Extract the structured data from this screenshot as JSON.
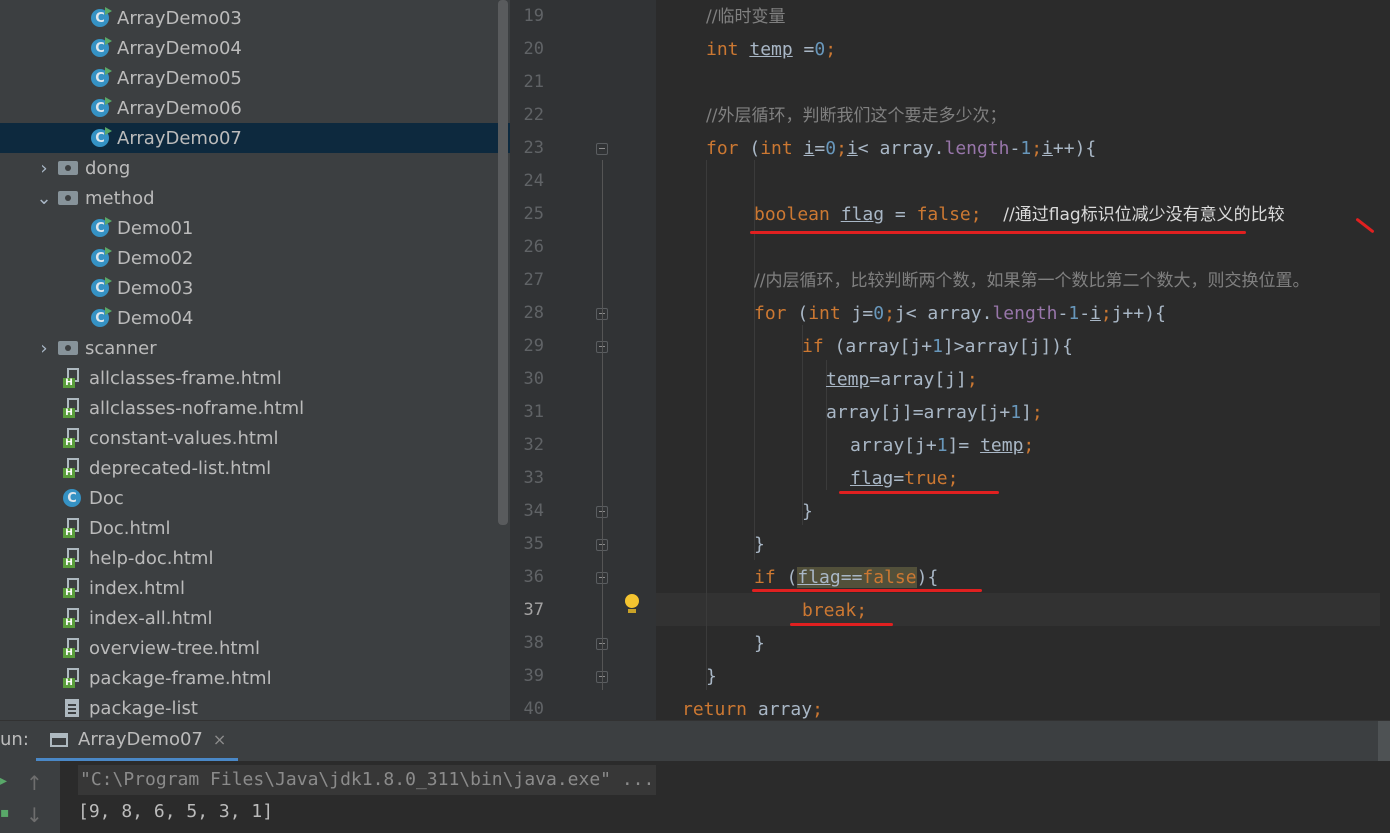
{
  "project_tree": {
    "items": [
      {
        "label": "ArrayDemo03",
        "kind": "class",
        "depth": 2
      },
      {
        "label": "ArrayDemo04",
        "kind": "class",
        "depth": 2
      },
      {
        "label": "ArrayDemo05",
        "kind": "class",
        "depth": 2
      },
      {
        "label": "ArrayDemo06",
        "kind": "class",
        "depth": 2
      },
      {
        "label": "ArrayDemo07",
        "kind": "class",
        "depth": 2,
        "selected": true
      },
      {
        "label": "dong",
        "kind": "folder",
        "depth": 1,
        "expanded": false
      },
      {
        "label": "method",
        "kind": "folder",
        "depth": 1,
        "expanded": true
      },
      {
        "label": "Demo01",
        "kind": "class",
        "depth": 2
      },
      {
        "label": "Demo02",
        "kind": "class",
        "depth": 2
      },
      {
        "label": "Demo03",
        "kind": "class",
        "depth": 2
      },
      {
        "label": "Demo04",
        "kind": "class",
        "depth": 2
      },
      {
        "label": "scanner",
        "kind": "folder",
        "depth": 1,
        "expanded": false
      },
      {
        "label": "allclasses-frame.html",
        "kind": "html",
        "depth": 1
      },
      {
        "label": "allclasses-noframe.html",
        "kind": "html",
        "depth": 1
      },
      {
        "label": "constant-values.html",
        "kind": "html",
        "depth": 1
      },
      {
        "label": "deprecated-list.html",
        "kind": "html",
        "depth": 1
      },
      {
        "label": "Doc",
        "kind": "class-plain",
        "depth": 1
      },
      {
        "label": "Doc.html",
        "kind": "html",
        "depth": 1
      },
      {
        "label": "help-doc.html",
        "kind": "html",
        "depth": 1
      },
      {
        "label": "index.html",
        "kind": "html",
        "depth": 1
      },
      {
        "label": "index-all.html",
        "kind": "html",
        "depth": 1
      },
      {
        "label": "overview-tree.html",
        "kind": "html",
        "depth": 1
      },
      {
        "label": "package-frame.html",
        "kind": "html",
        "depth": 1
      },
      {
        "label": "package-list",
        "kind": "file",
        "depth": 1
      }
    ]
  },
  "editor": {
    "active_line": "37",
    "lines": [
      {
        "num": "19",
        "indent": 0,
        "tokens": [
          {
            "t": "//临时变量",
            "c": "c"
          }
        ]
      },
      {
        "num": "20",
        "indent": 0,
        "tokens": [
          {
            "t": "int",
            "c": "k"
          },
          {
            "t": " "
          },
          {
            "t": "temp",
            "c": "u"
          },
          {
            "t": " ="
          },
          {
            "t": "0",
            "c": "n"
          },
          {
            "t": ";",
            "c": "k"
          }
        ]
      },
      {
        "num": "21",
        "indent": 0,
        "tokens": []
      },
      {
        "num": "22",
        "indent": 0,
        "tokens": [
          {
            "t": "//外层循环，判断我们这个要走多少次；",
            "c": "c"
          }
        ]
      },
      {
        "num": "23",
        "indent": 0,
        "tokens": [
          {
            "t": "for",
            "c": "k"
          },
          {
            "t": " ("
          },
          {
            "t": "int",
            "c": "k"
          },
          {
            "t": " "
          },
          {
            "t": "i",
            "c": "u"
          },
          {
            "t": "="
          },
          {
            "t": "0",
            "c": "n"
          },
          {
            "t": ";",
            "c": "k"
          },
          {
            "t": "i",
            "c": "u"
          },
          {
            "t": "< array."
          },
          {
            "t": "length",
            "c": "m"
          },
          {
            "t": "-"
          },
          {
            "t": "1",
            "c": "n"
          },
          {
            "t": ";",
            "c": "k"
          },
          {
            "t": "i",
            "c": "u"
          },
          {
            "t": "++){"
          }
        ]
      },
      {
        "num": "24",
        "indent": 0,
        "tokens": []
      },
      {
        "num": "25",
        "indent": 1,
        "tokens": [
          {
            "t": "boolean",
            "c": "k"
          },
          {
            "t": " "
          },
          {
            "t": "flag",
            "c": "u"
          },
          {
            "t": " = "
          },
          {
            "t": "false",
            "c": "k"
          },
          {
            "t": ";",
            "c": "k"
          },
          {
            "t": "  "
          },
          {
            "t": "//通过",
            "c": "c2"
          },
          {
            "t": "flag",
            "c": "c2"
          },
          {
            "t": "标识位减少没有意义的比较",
            "c": "c2"
          }
        ]
      },
      {
        "num": "26",
        "indent": 1,
        "tokens": []
      },
      {
        "num": "27",
        "indent": 1,
        "tokens": [
          {
            "t": "//内层循环，比较判断两个数，如果第一个数比第二个数大，则交换位置。",
            "c": "c"
          }
        ]
      },
      {
        "num": "28",
        "indent": 1,
        "tokens": [
          {
            "t": "for",
            "c": "k"
          },
          {
            "t": " ("
          },
          {
            "t": "int",
            "c": "k"
          },
          {
            "t": " j="
          },
          {
            "t": "0",
            "c": "n"
          },
          {
            "t": ";",
            "c": "k"
          },
          {
            "t": "j< array."
          },
          {
            "t": "length",
            "c": "m"
          },
          {
            "t": "-"
          },
          {
            "t": "1",
            "c": "n"
          },
          {
            "t": "-"
          },
          {
            "t": "i",
            "c": "u"
          },
          {
            "t": ";",
            "c": "k"
          },
          {
            "t": "j++){"
          }
        ]
      },
      {
        "num": "29",
        "indent": 2,
        "tokens": [
          {
            "t": "if",
            "c": "k"
          },
          {
            "t": " (array[j+"
          },
          {
            "t": "1",
            "c": "n"
          },
          {
            "t": "]>array[j]){"
          }
        ]
      },
      {
        "num": "30",
        "indent": 2.5,
        "tokens": [
          {
            "t": "temp",
            "c": "u"
          },
          {
            "t": "=array[j]"
          },
          {
            "t": ";",
            "c": "k"
          }
        ]
      },
      {
        "num": "31",
        "indent": 2.5,
        "tokens": [
          {
            "t": "array[j]=array[j+"
          },
          {
            "t": "1",
            "c": "n"
          },
          {
            "t": "]"
          },
          {
            "t": ";",
            "c": "k"
          }
        ]
      },
      {
        "num": "32",
        "indent": 3,
        "tokens": [
          {
            "t": "array[j+"
          },
          {
            "t": "1",
            "c": "n"
          },
          {
            "t": "]= "
          },
          {
            "t": "temp",
            "c": "u"
          },
          {
            "t": ";",
            "c": "k"
          }
        ]
      },
      {
        "num": "33",
        "indent": 3,
        "tokens": [
          {
            "t": "flag",
            "c": "u"
          },
          {
            "t": "="
          },
          {
            "t": "true",
            "c": "k"
          },
          {
            "t": ";",
            "c": "k"
          }
        ]
      },
      {
        "num": "34",
        "indent": 2,
        "tokens": [
          {
            "t": "}"
          }
        ]
      },
      {
        "num": "35",
        "indent": 1,
        "tokens": [
          {
            "t": "}"
          }
        ]
      },
      {
        "num": "36",
        "indent": 1,
        "tokens": [
          {
            "t": "if",
            "c": "k"
          },
          {
            "t": " ("
          },
          {
            "t": "flag",
            "c": "u hl"
          },
          {
            "t": "==",
            "c": "hl"
          },
          {
            "t": "false",
            "c": "k hl"
          },
          {
            "t": "){"
          }
        ]
      },
      {
        "num": "37",
        "indent": 2,
        "tokens": [
          {
            "t": "break",
            "c": "k"
          },
          {
            "t": ";",
            "c": "k"
          }
        ]
      },
      {
        "num": "38",
        "indent": 1,
        "tokens": [
          {
            "t": "}"
          }
        ]
      },
      {
        "num": "39",
        "indent": 0,
        "tokens": [
          {
            "t": "}"
          }
        ]
      },
      {
        "num": "40",
        "indent": -0.5,
        "tokens": [
          {
            "t": "return",
            "c": "k"
          },
          {
            "t": " array"
          },
          {
            "t": ";",
            "c": "k"
          }
        ]
      }
    ]
  },
  "run_panel": {
    "label": "un:",
    "tab_title": "ArrayDemo07",
    "tab_close": "×",
    "console": [
      "\"C:\\Program Files\\Java\\jdk1.8.0_311\\bin\\java.exe\" ...",
      "[9, 8, 6, 5, 3, 1]"
    ]
  },
  "colors": {
    "keyword": "#cc7832",
    "number": "#6897bb",
    "comment": "#808080",
    "field": "#9876aa",
    "annotation_red": "#e02020",
    "selection": "#0d293e"
  }
}
